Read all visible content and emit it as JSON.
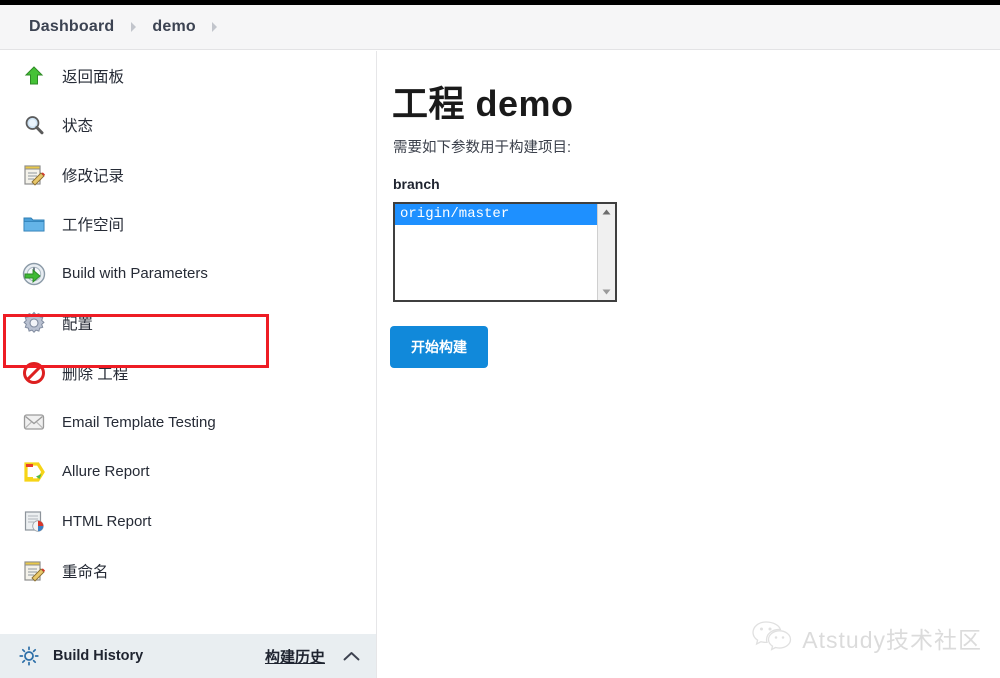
{
  "header": {
    "breadcrumbs": [
      {
        "label": "Dashboard",
        "icon": "none"
      },
      {
        "label": "demo",
        "icon": "none"
      }
    ],
    "separator_icon": "chevron-right-icon"
  },
  "sidebar": {
    "items": [
      {
        "label": "返回面板",
        "icon": "up-arrow-icon",
        "highlighted": false
      },
      {
        "label": "状态",
        "icon": "magnifier-icon",
        "highlighted": false
      },
      {
        "label": "修改记录",
        "icon": "notepad-pencil-icon",
        "highlighted": false
      },
      {
        "label": "工作空间",
        "icon": "folder-icon",
        "highlighted": false
      },
      {
        "label": "Build with Parameters",
        "icon": "build-clock-icon",
        "highlighted": true
      },
      {
        "label": "配置",
        "icon": "gear-icon",
        "highlighted": false
      },
      {
        "label": "删除 工程",
        "icon": "delete-forbidden-icon",
        "highlighted": false
      },
      {
        "label": "Email Template Testing",
        "icon": "envelope-icon",
        "highlighted": false
      },
      {
        "label": "Allure Report",
        "icon": "allure-icon",
        "highlighted": false
      },
      {
        "label": "HTML Report",
        "icon": "html-report-chart-icon",
        "highlighted": false
      },
      {
        "label": "重命名",
        "icon": "notepad-pencil-icon",
        "highlighted": false
      }
    ],
    "build_history": {
      "icon": "build-history-sun-icon",
      "title": "Build History",
      "link_label": "构建历史",
      "collapse_icon": "chevron-up-icon"
    }
  },
  "main": {
    "title": "工程 demo",
    "description": "需要如下参数用于构建项目:",
    "parameter": {
      "name": "branch",
      "options": [
        "origin/master"
      ],
      "selected": "origin/master",
      "scrollbar": {
        "up_icon": "triangle-up-icon",
        "down_icon": "triangle-down-icon"
      }
    },
    "build_button_label": "开始构建"
  },
  "watermark": {
    "icon": "wechat-icon",
    "text": "Atstudy技术社区"
  },
  "colors": {
    "accent_blue": "#1189da",
    "selection_blue": "#1e90ff",
    "annotation_red": "#ee1c24",
    "header_bg": "#f6f6f7",
    "footer_bg": "#e9eef1"
  }
}
